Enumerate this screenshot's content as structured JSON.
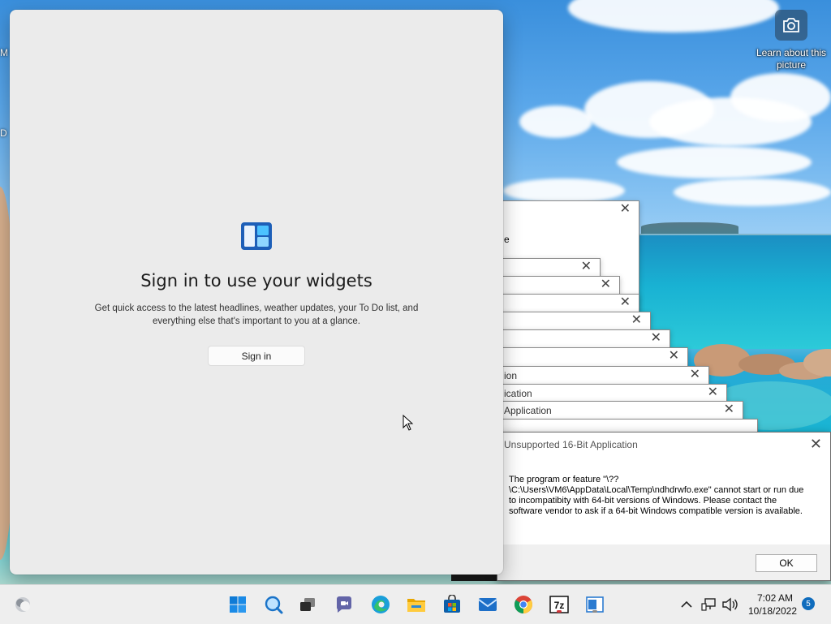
{
  "desktop": {
    "edge_labels": [
      "M",
      "D"
    ],
    "learn_picture_label": "Learn about this picture",
    "camera_icon": "camera-icon"
  },
  "widgets_panel": {
    "icon": "widgets-icon",
    "title": "Sign in to use your widgets",
    "description": "Get quick access to the latest headlines, weather updates, your To Do list, and everything else that's important to you at a glance.",
    "sign_in_label": "Sign in"
  },
  "stacked_dialogs": [
    {
      "title": ""
    },
    {
      "title": "e"
    },
    {
      "title": ""
    },
    {
      "title": ""
    },
    {
      "title": ""
    },
    {
      "title": ""
    },
    {
      "title": ""
    },
    {
      "title": ""
    },
    {
      "title": "ion"
    },
    {
      "title": "ication"
    },
    {
      "title": "Application"
    }
  ],
  "error_dialog": {
    "title": "Unsupported 16-Bit Application",
    "message": "The program or feature \"\\??\\C:\\Users\\VM6\\AppData\\Local\\Temp\\ndhdrwfo.exe\" cannot start or run due to incompatibity with 64-bit versions of Windows. Please contact the software vendor to ask if a 64-bit Windows compatible version is available.",
    "ok_label": "OK"
  },
  "taskbar": {
    "items": [
      {
        "name": "start-icon"
      },
      {
        "name": "search-icon"
      },
      {
        "name": "task-view-icon"
      },
      {
        "name": "chat-icon"
      },
      {
        "name": "edge-icon"
      },
      {
        "name": "file-explorer-icon"
      },
      {
        "name": "store-icon"
      },
      {
        "name": "mail-icon"
      },
      {
        "name": "chrome-icon"
      },
      {
        "name": "7zip-icon"
      },
      {
        "name": "window-app-icon"
      }
    ],
    "time": "7:02 AM",
    "date": "10/18/2022",
    "notification_count": "5"
  }
}
